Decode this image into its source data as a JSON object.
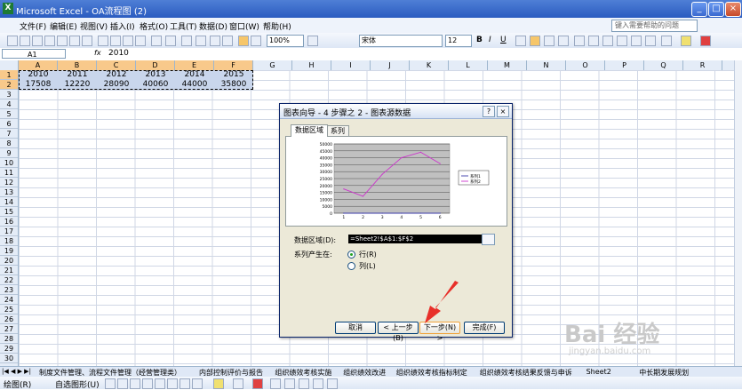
{
  "window": {
    "title": "Microsoft Excel - OA流程图 (2)",
    "app_icon": "X"
  },
  "menu": {
    "items": [
      "文件(F)",
      "编辑(E)",
      "视图(V)",
      "插入(I)",
      "格式(O)",
      "工具(T)",
      "数据(D)",
      "窗口(W)",
      "帮助(H)"
    ],
    "help_placeholder": "键入需要帮助的问题"
  },
  "toolbar": {
    "zoom": "100%",
    "font": "宋体",
    "font_size": "12",
    "bold": "B",
    "italic": "I",
    "underline": "U"
  },
  "formula": {
    "cell_ref": "A1",
    "fx": "fx",
    "value": "2010"
  },
  "grid": {
    "columns": [
      "A",
      "B",
      "C",
      "D",
      "E",
      "F",
      "G",
      "H",
      "I",
      "J",
      "K",
      "L",
      "M",
      "N",
      "O",
      "P",
      "Q",
      "R"
    ],
    "rows": [
      "1",
      "2",
      "3",
      "4",
      "5",
      "6",
      "7",
      "8",
      "9",
      "10",
      "11",
      "12",
      "13",
      "14",
      "15",
      "16",
      "17",
      "18",
      "19",
      "20",
      "21",
      "22",
      "23",
      "24",
      "25",
      "26",
      "27",
      "28",
      "29",
      "30"
    ],
    "data": [
      [
        "2010",
        "2011",
        "2012",
        "2013",
        "2014",
        "2015"
      ],
      [
        "17508",
        "12220",
        "28090",
        "40060",
        "44000",
        "35800"
      ]
    ]
  },
  "sheet_tabs": {
    "nav": "|◀ ◀ ▶ ▶|",
    "labels": [
      "制度文件管理、流程文件管理（经营管理类）",
      "内部控制评价与报告",
      "组织绩效考核实施",
      "组织绩效改进",
      "组织绩效考核指标制定",
      "组织绩效考核结果反馈与申诉",
      "Sheet2",
      "中长期发展规划"
    ]
  },
  "drawbar": {
    "draw": "绘图(R)",
    "autoshape": "自选图形(U)"
  },
  "dialog": {
    "title": "图表向导 - 4 步骤之 2 - 图表源数据",
    "help": "?",
    "close": "×",
    "tabs": [
      "数据区域",
      "系列"
    ],
    "range_label": "数据区域(D):",
    "range_value": "=Sheet2!$A$1:$F$2",
    "series_in_label": "系列产生在:",
    "options": [
      "行(R)",
      "列(L)"
    ],
    "buttons": {
      "cancel": "取消",
      "back": "< 上一步(B)",
      "next": "下一步(N) >",
      "finish": "完成(F)"
    }
  },
  "chart_data": {
    "type": "line",
    "categories": [
      "1",
      "2",
      "3",
      "4",
      "5",
      "6"
    ],
    "series": [
      {
        "name": "系列1",
        "values": [
          0,
          0,
          0,
          0,
          0,
          0
        ],
        "color": "#3a3aa8"
      },
      {
        "name": "系列2",
        "values": [
          17508,
          12220,
          28090,
          40060,
          44000,
          35800
        ],
        "color": "#cc33cc"
      }
    ],
    "yticks": [
      "50000",
      "45000",
      "40000",
      "35000",
      "30000",
      "25000",
      "20000",
      "15000",
      "10000",
      "5000",
      "0"
    ],
    "ylim": [
      0,
      50000
    ],
    "grid": true,
    "legend": "right"
  },
  "watermark": {
    "text": "Bai 经验",
    "sub": "jingyan.baidu.com"
  },
  "colors": {
    "selection": "#c9d6ec",
    "header_selected": "#f8c98b",
    "arrow": "#e8302a"
  }
}
